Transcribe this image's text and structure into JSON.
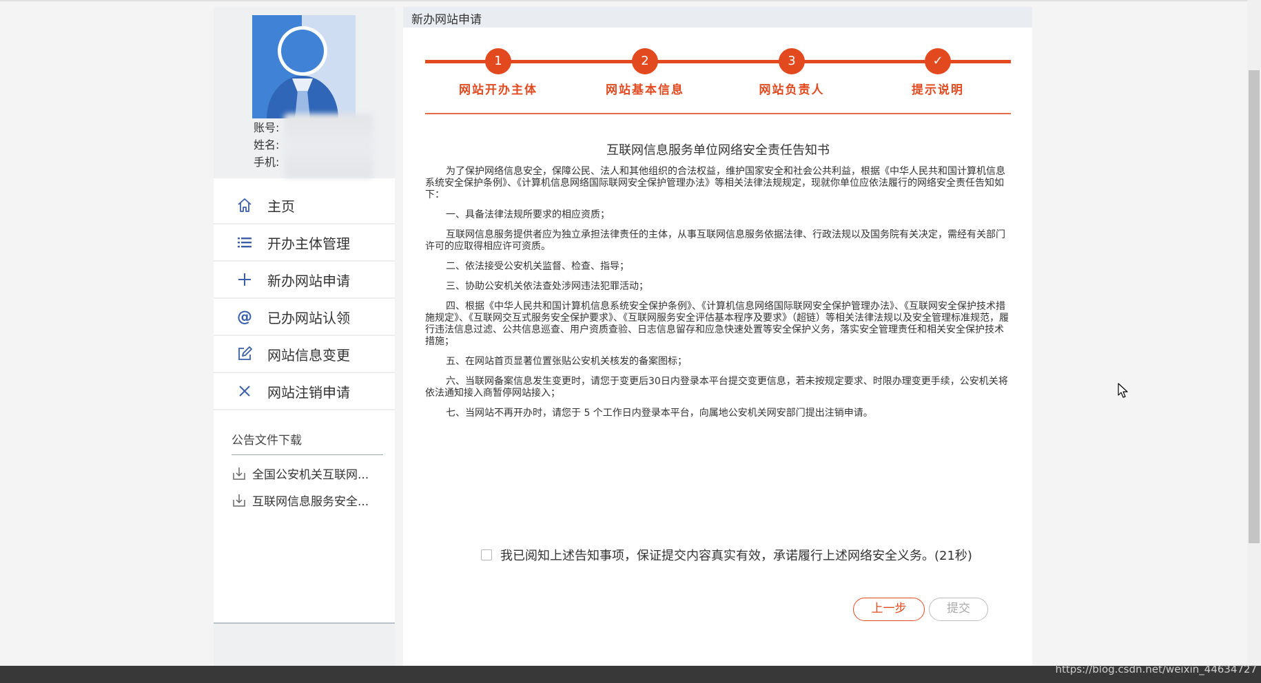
{
  "page": {
    "breadcrumb": "新办网站申请"
  },
  "profile": {
    "account_label": "账号:",
    "name_label": "姓名:",
    "phone_label": "手机:"
  },
  "menu": [
    {
      "label": "主页",
      "icon": "home-icon"
    },
    {
      "label": "开办主体管理",
      "icon": "list-icon"
    },
    {
      "label": "新办网站申请",
      "icon": "plus-icon"
    },
    {
      "label": "已办网站认领",
      "icon": "at-icon"
    },
    {
      "label": "网站信息变更",
      "icon": "edit-icon"
    },
    {
      "label": "网站注销申请",
      "icon": "close-icon"
    }
  ],
  "notice": {
    "title": "公告文件下载",
    "files": [
      "全国公安机关互联网...",
      "互联网信息服务安全..."
    ]
  },
  "steps": [
    {
      "num": "1",
      "label": "网站开办主体"
    },
    {
      "num": "2",
      "label": "网站基本信息"
    },
    {
      "num": "3",
      "label": "网站负责人"
    },
    {
      "num": "✓",
      "label": "提示说明"
    }
  ],
  "document": {
    "title": "互联网信息服务单位网络安全责任告知书",
    "paragraphs": [
      "为了保护网络信息安全，保障公民、法人和其他组织的合法权益，维护国家安全和社会公共利益，根据《中华人民共和国计算机信息系统安全保护条例》、《计算机信息网络国际联网安全保护管理办法》等相关法律法规规定，现就你单位应依法履行的网络安全责任告知如下：",
      "一、具备法律法规所要求的相应资质；",
      "互联网信息服务提供者应为独立承担法律责任的主体，从事互联网信息服务依据法律、行政法规以及国务院有关决定，需经有关部门许可的应取得相应许可资质。",
      "二、依法接受公安机关监督、检查、指导；",
      "三、协助公安机关依法查处涉网违法犯罪活动；",
      "四、根据《中华人民共和国计算机信息系统安全保护条例》、《计算机信息网络国际联网安全保护管理办法》、《互联网安全保护技术措施规定》、《互联网交互式服务安全保护要求》、《互联网服务安全评估基本程序及要求》（超链）等相关法律法规以及安全管理标准规范，履行违法信息过滤、公共信息巡查、用户资质查验、日志信息留存和应急快速处置等安全保护义务，落实安全管理责任和相关安全保护技术措施；",
      "五、在网站首页显著位置张贴公安机关核发的备案图标；",
      "六、当联网备案信息发生变更时，请您于变更后30日内登录本平台提交变更信息，若未按规定要求、时限办理变更手续，公安机关将依法通知接入商暂停网站接入；",
      "七、当网站不再开办时，请您于 5 个工作日内登录本平台，向属地公安机关网安部门提出注销申请。"
    ]
  },
  "agreement": {
    "text": "我已阅知上述告知事项，保证提交内容真实有效，承诺履行上述网络安全义务。(21秒)",
    "checked": false
  },
  "buttons": {
    "prev": "上一步",
    "submit": "提交"
  },
  "watermark": "https://blog.csdn.net/weixin_44634727",
  "colors": {
    "accent": "#e2491f",
    "menu_icon": "#3a5ea8"
  }
}
